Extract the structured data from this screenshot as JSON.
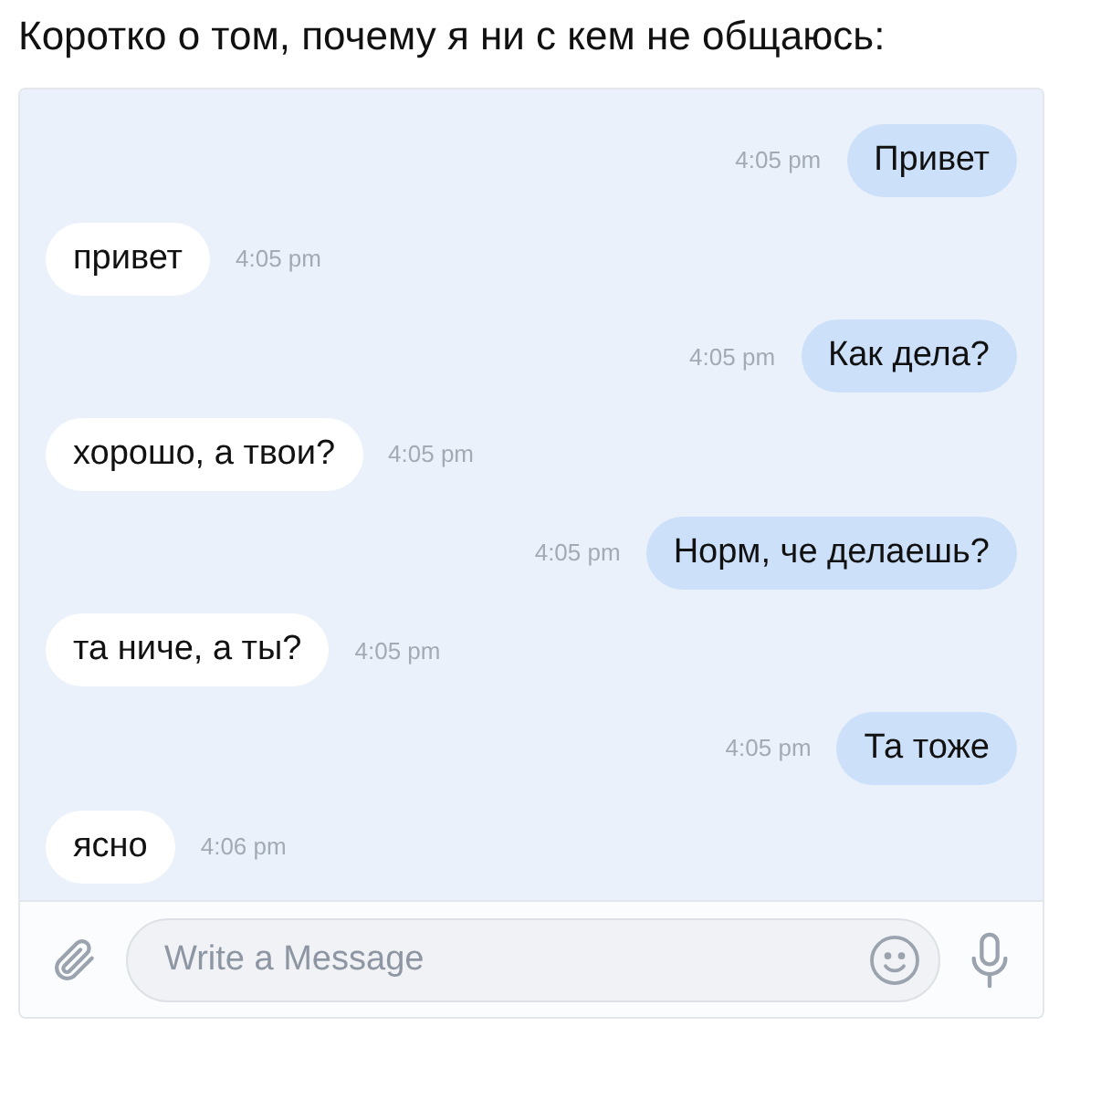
{
  "caption": "Коротко о том, почему я ни с кем не общаюсь:",
  "messages": [
    {
      "kind": "out",
      "text": "Привет",
      "time": "4:05 pm"
    },
    {
      "kind": "in",
      "text": "привет",
      "time": "4:05 pm"
    },
    {
      "kind": "out",
      "text": "Как дела?",
      "time": "4:05 pm"
    },
    {
      "kind": "in",
      "text": "хорошо, а твои?",
      "time": "4:05 pm"
    },
    {
      "kind": "out",
      "text": "Норм, че делаешь?",
      "time": "4:05 pm"
    },
    {
      "kind": "in",
      "text": "та ниче, а ты?",
      "time": "4:05 pm"
    },
    {
      "kind": "out",
      "text": "Та тоже",
      "time": "4:05 pm"
    },
    {
      "kind": "in",
      "text": "ясно",
      "time": "4:06 pm"
    }
  ],
  "composer": {
    "placeholder": "Write a Message"
  }
}
